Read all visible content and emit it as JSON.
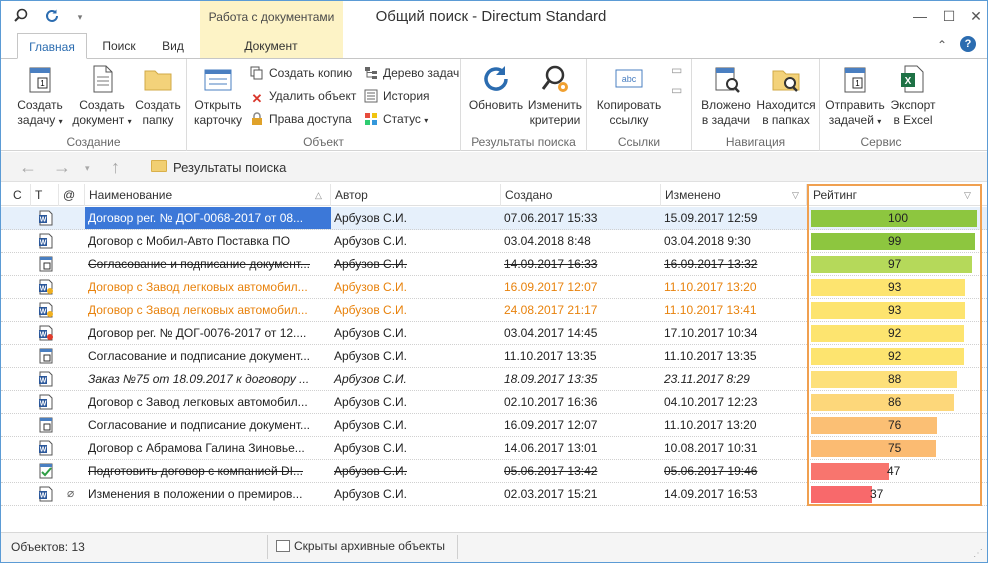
{
  "window": {
    "title": "Общий поиск - Directum Standard",
    "context_group": "Работа с документами"
  },
  "tabs": [
    {
      "label": "Главная",
      "active": true
    },
    {
      "label": "Поиск",
      "active": false
    },
    {
      "label": "Вид",
      "active": false
    },
    {
      "label": "Документ",
      "active": false
    }
  ],
  "ribbon": {
    "groups": {
      "create": "Создание",
      "object": "Объект",
      "results": "Результаты поиска",
      "links": "Ссылки",
      "navigation": "Навигация",
      "service": "Сервис"
    },
    "buttons": {
      "create_task_1": "Создать",
      "create_task_2": "задачу",
      "create_doc_1": "Создать",
      "create_doc_2": "документ",
      "create_folder_1": "Создать",
      "create_folder_2": "папку",
      "open_card_1": "Открыть",
      "open_card_2": "карточку",
      "create_copy": "Создать копию",
      "delete_object": "Удалить объект",
      "access_rights": "Права доступа",
      "task_tree": "Дерево задач",
      "history": "История",
      "status": "Статус",
      "refresh": "Обновить",
      "change_criteria_1": "Изменить",
      "change_criteria_2": "критерии",
      "copy_link_1": "Копировать",
      "copy_link_2": "ссылку",
      "nested_tasks_1": "Вложено",
      "nested_tasks_2": "в задачи",
      "in_folders_1": "Находится",
      "in_folders_2": "в папках",
      "send_task_1": "Отправить",
      "send_task_2": "задачей",
      "export_excel_1": "Экспорт",
      "export_excel_2": "в Excel"
    }
  },
  "nav": {
    "breadcrumb": "Результаты поиска"
  },
  "grid": {
    "columns": {
      "c": "С",
      "t": "Т",
      "at": "@",
      "name": "Наименование",
      "author": "Автор",
      "created": "Создано",
      "modified": "Изменено",
      "rating": "Рейтинг"
    },
    "rows": [
      {
        "name": "Договор рег. № ДОГ-0068-2017 от 08...",
        "author": "Арбузов С.И.",
        "created": "07.06.2017 15:33",
        "modified": "15.09.2017 12:59",
        "rating": 100,
        "rating_text": "100",
        "style": "selected",
        "icon": "word-doc",
        "bar_color": "#8dc63f"
      },
      {
        "name": "Договор с Мобил-Авто Поставка ПО",
        "author": "Арбузов С.И.",
        "created": "03.04.2018 8:48",
        "modified": "03.04.2018 9:30",
        "rating": 99,
        "rating_text": "99",
        "style": "",
        "icon": "word-doc",
        "bar_color": "#8dc63f"
      },
      {
        "name": "Согласование и подписание документ...",
        "author": "Арбузов С.И.",
        "created": "14.09.2017 16:33",
        "modified": "16.09.2017 13:32",
        "rating": 97,
        "rating_text": "97",
        "style": "strike",
        "icon": "task",
        "bar_color": "#b5d95a"
      },
      {
        "name": "Договор с Завод легковых автомобил...",
        "author": "Арбузов С.И.",
        "created": "16.09.2017 12:07",
        "modified": "11.10.2017 13:20",
        "rating": 93,
        "rating_text": "93",
        "style": "orange",
        "icon": "word-doc-lock",
        "bar_color": "#fde46f"
      },
      {
        "name": "Договор с Завод легковых автомобил...",
        "author": "Арбузов С.И.",
        "created": "24.08.2017 21:17",
        "modified": "11.10.2017 13:41",
        "rating": 93,
        "rating_text": "93",
        "style": "orange",
        "icon": "word-doc-lock",
        "bar_color": "#fde46f"
      },
      {
        "name": "Договор рег. № ДОГ-0076-2017 от 12....",
        "author": "Арбузов С.И.",
        "created": "03.04.2017 14:45",
        "modified": "17.10.2017 10:34",
        "rating": 92,
        "rating_text": "92",
        "style": "",
        "icon": "word-doc-red",
        "bar_color": "#fde46f"
      },
      {
        "name": "Согласование и подписание документ...",
        "author": "Арбузов С.И.",
        "created": "11.10.2017 13:35",
        "modified": "11.10.2017 13:35",
        "rating": 92,
        "rating_text": "92",
        "style": "",
        "icon": "task",
        "bar_color": "#fde46f"
      },
      {
        "name": "Заказ №75 от 18.09.2017 к договору ...",
        "author": "Арбузов С.И.",
        "created": "18.09.2017 13:35",
        "modified": "23.11.2017 8:29",
        "rating": 88,
        "rating_text": "88",
        "style": "italic",
        "icon": "word-doc",
        "bar_color": "#fde07a"
      },
      {
        "name": "Договор с Завод легковых автомобил...",
        "author": "Арбузов С.И.",
        "created": "02.10.2017 16:36",
        "modified": "04.10.2017 12:23",
        "rating": 86,
        "rating_text": "86",
        "style": "",
        "icon": "word-doc",
        "bar_color": "#fdd77a"
      },
      {
        "name": "Согласование и подписание документ...",
        "author": "Арбузов С.И.",
        "created": "16.09.2017 12:07",
        "modified": "11.10.2017 13:20",
        "rating": 76,
        "rating_text": "76",
        "style": "",
        "icon": "task",
        "bar_color": "#fbbf74"
      },
      {
        "name": "Договор с Абрамова Галина Зиновье...",
        "author": "Арбузов С.И.",
        "created": "14.06.2017 13:01",
        "modified": "10.08.2017 10:31",
        "rating": 75,
        "rating_text": "75",
        "style": "",
        "icon": "word-doc",
        "bar_color": "#fbbb72"
      },
      {
        "name": "Подготовить договор с компанией DI...",
        "author": "Арбузов С.И.",
        "created": "05.06.2017 13:42",
        "modified": "05.06.2017 19:46",
        "rating": 47,
        "rating_text": "47",
        "style": "strike",
        "icon": "task-done",
        "bar_color": "#f8756e"
      },
      {
        "name": "Изменения в положении о премиров...",
        "author": "Арбузов С.И.",
        "created": "02.03.2017 15:21",
        "modified": "14.09.2017 16:53",
        "rating": 37,
        "rating_text": "37",
        "style": "",
        "icon": "word-doc",
        "attachment": true,
        "bar_color": "#f8696b"
      }
    ]
  },
  "status": {
    "objects": "Объектов: 13",
    "archive": "Скрыты архивные объекты"
  }
}
